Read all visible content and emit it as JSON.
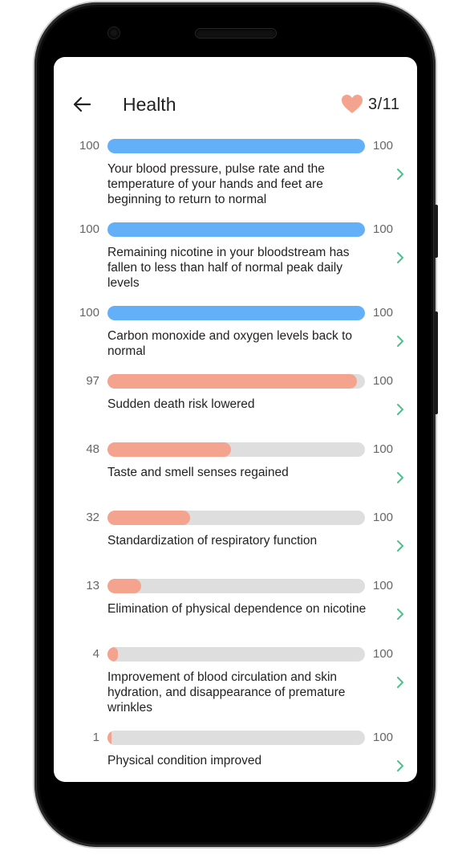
{
  "header": {
    "title": "Health",
    "counter": "3/11",
    "back_icon": "arrow-left-icon",
    "heart_icon": "heart-icon"
  },
  "colors": {
    "completed": "#64b0f8",
    "in_progress": "#f4a38f",
    "track": "#dedede",
    "chevron": "#4cc08a",
    "heart": "#f4a38f"
  },
  "items": [
    {
      "start": "100",
      "end": "100",
      "progress": 1.0,
      "status": "completed",
      "text": "Your blood pressure, pulse rate and the temperature of your hands and feet are beginning to return to normal"
    },
    {
      "start": "100",
      "end": "100",
      "progress": 1.0,
      "status": "completed",
      "text": "Remaining nicotine in your bloodstream has fallen to less than half of normal peak daily levels"
    },
    {
      "start": "100",
      "end": "100",
      "progress": 1.0,
      "status": "completed",
      "text": "Carbon monoxide and oxygen levels back to normal"
    },
    {
      "start": "97",
      "end": "100",
      "progress": 0.97,
      "status": "in_progress",
      "text": "Sudden death risk lowered"
    },
    {
      "start": "48",
      "end": "100",
      "progress": 0.48,
      "status": "in_progress",
      "text": "Taste and smell senses regained"
    },
    {
      "start": "32",
      "end": "100",
      "progress": 0.32,
      "status": "in_progress",
      "text": "Standardization of respiratory function"
    },
    {
      "start": "13",
      "end": "100",
      "progress": 0.13,
      "status": "in_progress",
      "text": "Elimination of physical dependence on nicotine"
    },
    {
      "start": "4",
      "end": "100",
      "progress": 0.04,
      "status": "in_progress",
      "text": "Improvement of blood circulation and skin hydration, and disappearance of premature wrinkles"
    },
    {
      "start": "1",
      "end": "100",
      "progress": 0.01,
      "status": "in_progress",
      "text": "Physical condition improved"
    }
  ]
}
